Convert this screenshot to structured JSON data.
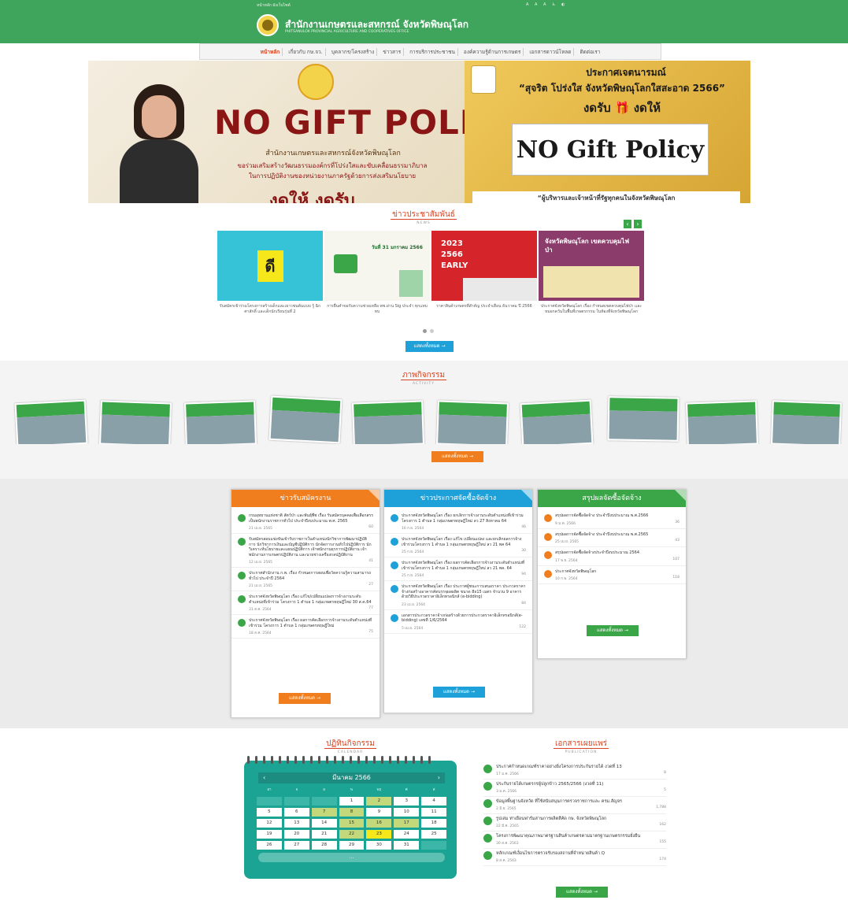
{
  "header": {
    "top_left": "หน้าหลัก   ผังเว็บไซต์",
    "top_right": "A  A  A  ♿  ◐",
    "title": "สำนักงานเกษตรและสหกรณ์ จังหวัดพิษณุโลก",
    "subtitle": "PHITSANULOK PROVINCIAL AGRICULTURE AND COOPERATIVES OFFICE"
  },
  "nav": [
    "หน้าหลัก",
    "เกี่ยวกับ กษ.จว.",
    "บุคลากร/โครงสร้าง",
    "ข่าวสาร",
    "การบริการประชาชน",
    "องค์ความรู้ด้านการเกษตร",
    "เอกสารดาวน์โหลด",
    "ติดต่อเรา"
  ],
  "banner": {
    "left_big": "NO GIFT POLICY",
    "left_line1": "สำนักงานเกษตรและสหกรณ์จังหวัดพิษณุโลก",
    "left_line2": "ขอร่วมเสริมสร้างวัฒนธรรมองค์กรที่โปร่งใสและขับเคลื่อนธรรมาภิบาล",
    "left_line3": "ในการปฏิบัติงานของหน่วยงานภาครัฐด้วยการส่งเสริมนโยบาย",
    "left_bottom": "งดให้ งดรับ",
    "right_t1": "ประกาศเจตนารมณ์",
    "right_t2": "“สุจริต โปร่งใส จังหวัดพิษณุโลกใสสะอาด 2566”",
    "right_t3": "งดรับ 🎁 งดให้",
    "right_box": "NO Gift Policy",
    "right_bottom": "“ผู้บริหารและเจ้าหน้าที่รัฐทุกคนในจังหวัดพิษณุโลก"
  },
  "news": {
    "title": "ข่าวประชาสัมพันธ์",
    "sub": "NEWS",
    "items": [
      {
        "caption": "รับสมัครเข้าร่วมโครงการสร้างเด็กและเยาวชนต้นแบบ รู้ ฉิก ศาสักดิ์ และเด็กนักเรียนรุ่นที่ 2",
        "color": "#36c3d8",
        "label": "ดี"
      },
      {
        "caption": "การยื่นคำขอรับความช่วยเหลือ พช.ผ่าน Sig ประจำ ทุกแทบทบ",
        "color": "#f3f3e8",
        "label": "วันที่ 31 มกราคม 2566"
      },
      {
        "caption": "ราคาสินค้าเกษตรที่สำคัญ ประจำเดือน ธันวาคม ปี 2566",
        "color": "#d6242b",
        "label": "2023 2566 EARLY"
      },
      {
        "caption": "ประกาศจังหวัดพิษณุโลก เรื่อง กำหนดเขตควบคุมไฟป่า และหมอกควันในพื้นที่เกษตรกรรม ในท้องที่จังหวัดพิษณุโลก",
        "color": "#8b3c6a",
        "label": "จังหวัดพิษณุโลก เขตควบคุมไฟป่า"
      }
    ],
    "more": "แสดงทั้งหมด →"
  },
  "activity": {
    "title": "ภาพกิจกรรม",
    "sub": "ACTIVITY",
    "more": "แสดงทั้งหมด →"
  },
  "panels": [
    {
      "title": "ข่าวรับสมัครงาน",
      "color": "#f07e1e",
      "more": "แสดงทั้งหมด →",
      "items": [
        {
          "title": "กรมอุทยานแห่งชาติ สัตว์ป่า และพันธุ์พืช เรื่อง รับสมัครบุคคลเพื่อเลือกสรรเป็นพนักงานราชการทั่วไป ประจำปีงบประมาณ พ.ศ. 2565",
          "date": "21 เม.ย. 2565",
          "views": "60"
        },
        {
          "title": "รับสมัครสอบแข่งขันเข้ารับราชการในตำแหน่งนักวิชาการพัฒนาปฏิบัติการ นักวิชาการเงินและบัญชีปฏิบัติการ นักจัดการงานทั่วไปปฏิบัติการ นักวิเคราะห์นโยบายและแผนปฏิบัติการ เจ้าพนักงานธุรการปฏิบัติงาน เจ้าพนักงานการเกษตรปฏิบัติงาน และนายช่างเครื่องกลปฏิบัติงาน",
          "date": "12 เม.ย. 2565",
          "views": "41"
        },
        {
          "title": "ประกาศสำนักงาน ก.พ. เรื่อง กำหนดการสอบเพื่อวัดความรู้ความสามารถทั่วไป ประจำปี 2564",
          "date": "21 เม.ย. 2565",
          "views": "27"
        },
        {
          "title": "ประกาศจังหวัดพิษณุโลก เรื่อง แก้ไข/เปลี่ยนแปลงการจ้างงานระดับตำแหน่งที่เข้าร่วม โครงการ 1 ตำบล 1 กลุ่มเกษตรทฤษฎีใหม่ 30 ส.ค.64",
          "date": "31 ส.ค. 2564",
          "views": "77"
        },
        {
          "title": "ประกาศจังหวัดพิษณุโลก เรื่อง ผลการคัดเลือกการจ้างงานระดับตำแหน่งที่เข้าร่วม โครงการ 1 ตำบล 1 กลุ่มเกษตรทฤษฎีใหม่",
          "date": "18 ส.ค. 2564",
          "views": "75"
        }
      ]
    },
    {
      "title": "ข่าวประกาศจัดซื้อจัดจ้าง",
      "color": "#1ea1d8",
      "more": "แสดงทั้งหมด →",
      "items": [
        {
          "title": "ประกาศจังหวัดพิษณุโลก เรื่อง ยกเลิกการจ้างงานระดับตำแหน่งที่เข้าร่วมโครงการ 1 ตำบล 1 กลุ่มเกษตรทฤษฎีใหม่ ลว 27 สิงหาคม 64",
          "date": "16 ก.ย. 2564",
          "views": "46"
        },
        {
          "title": "ประกาศจังหวัดพิษณุโลก เรื่อง แก้ไข เปลี่ยนแปลง และยกเลิกผลการจ้างเข้าร่วมโครงการ 1 ตำบล 1 กลุ่มเกษตรทฤษฎีใหม่ ลว 21 พค 64",
          "date": "25 ก.ย. 2564",
          "views": "30"
        },
        {
          "title": "ประกาศจังหวัดพิษณุโลก เรื่อง ผลการคัดเลือกการจ้างงานระดับตำแหน่งที่เข้าร่วมโครงการ 1 ตำบล 1 กลุ่มเกษตรทฤษฎีใหม่ ลว 21 พค. 64",
          "date": "25 ก.ย. 2564",
          "views": "94"
        },
        {
          "title": "ประกาศจังหวัดพิษณุโลก เรื่อง ประกาศผู้ชนะการเสนอราคา ประกวดราคาจ้างก่อสร้างอาคารคัดบรรจุผลผลิต ขนาด 8x15 เมตร จำนวน 9 อาคาร ด้วยวิธีประกวดราคาอิเล็กทรอนิกส์ (e-bidding)",
          "date": "23 เม.ย. 2564",
          "views": "84"
        },
        {
          "title": "เอกสารประกวดราคาจ้างก่อสร้างด้วยการประกวดราคาอิเล็กทรอนิกส์(e-bidding) เลขที่ 1/6/2564",
          "date": "5 เม.ย. 2564",
          "views": "122"
        }
      ]
    },
    {
      "title": "สรุปผลจัดซื้อจัดจ้าง",
      "color": "#3aa648",
      "more": "แสดงทั้งหมด →",
      "items": [
        {
          "title": "สรุปผลการจัดซื้อจัดจ้าง ประจำปีงบประมาณ พ.ศ.2566",
          "date": "9 ม.ค. 2566",
          "views": "36"
        },
        {
          "title": "สรุปผลการจัดซื้อจัดจ้าง ประจำปีงบประมาณ พ.ศ.2565",
          "date": "25 เม.ย. 2565",
          "views": "43"
        },
        {
          "title": "สรุปผลการจัดซื้อจัดจ้างประจำปีงบประมาณ 2564",
          "date": "17 พ.ย. 2564",
          "views": "107"
        },
        {
          "title": "ประกาศจังหวัดพิษณุโลก",
          "date": "10 ก.พ. 2564",
          "views": "118"
        }
      ]
    }
  ],
  "calendar": {
    "title": "ปฏิทินกิจกรรม",
    "sub": "CALENDAR",
    "month": "มีนาคม 2566",
    "dow": [
      "อา",
      "จ",
      "อ",
      "พ",
      "พฤ",
      "ศ",
      "ส"
    ],
    "weeks": [
      [
        "",
        "",
        "",
        "1",
        "2",
        "3",
        "4"
      ],
      [
        "5",
        "6",
        "7",
        "8",
        "9",
        "10",
        "11"
      ],
      [
        "12",
        "13",
        "14",
        "15",
        "16",
        "17",
        "18"
      ],
      [
        "19",
        "20",
        "21",
        "22",
        "23",
        "24",
        "25"
      ],
      [
        "26",
        "27",
        "28",
        "29",
        "30",
        "31",
        ""
      ]
    ],
    "highlights": [
      "2",
      "7",
      "8",
      "15",
      "16",
      "17",
      "22"
    ],
    "today": "23",
    "foot": "..."
  },
  "publication": {
    "title": "เอกสารเผยแพร่",
    "sub": "PUBLICATION",
    "more": "แสดงทั้งหมด →",
    "items": [
      {
        "title": "ประกาศกำหนดเกณฑ์ราคาอย่างยิ่งโครงการประกันรายได้ งวดที่ 13",
        "date": "17 ม.ค. 2566",
        "views": "8"
      },
      {
        "title": "ประกันรายได้เกษตรกรผู้ปลูกข้าว 2565/2566 (งวดที่ 11)",
        "date": "3 ม.ค. 2566",
        "views": "5"
      },
      {
        "title": "ข้อมูลพื้นฐานจังหวัด ที่ใช้สนับสนุนการตรวจราชการและ ครม.สัญจร",
        "date": "2 มิ.ย. 2565",
        "views": "1,788"
      },
      {
        "title": "รูปเล่ม ท่าเยือนฟาร์มสานการผลิตสีคัด กษ. จังหวัดพิษณุโลก",
        "date": "22 มี.ค. 2565",
        "views": "162"
      },
      {
        "title": "โครงการพัฒนาคุณภาพมาตรฐานสินค้าเกษตรตามมาตรฐานเกษตรกรรมยั่งยืน",
        "date": "30 ส.ค. 2563",
        "views": "155"
      },
      {
        "title": "หลักเกณฑ์เงื่อนไขการตรวจรับรองสถานที่จำหน่ายสินค้า Q",
        "date": "8 ส.ค. 2563",
        "views": "174"
      }
    ]
  }
}
